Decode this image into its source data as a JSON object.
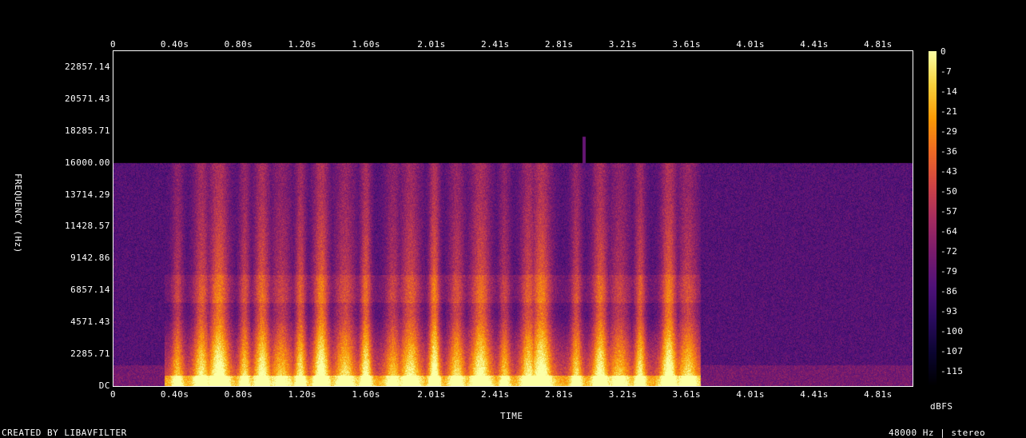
{
  "footer": {
    "left": "CREATED BY LIBAVFILTER",
    "right": "48000 Hz | stereo"
  },
  "colors": {
    "background": "#000000",
    "axis": "#ffffff",
    "colormap": [
      "#000000",
      "#0b0530",
      "#2a0b5e",
      "#51127a",
      "#7a1b6d",
      "#a52c60",
      "#cf4446",
      "#ed6925",
      "#fb9b06",
      "#f7d13d",
      "#fcffa4"
    ]
  },
  "chart_data": {
    "type": "heatmap",
    "title": "",
    "xlabel": "TIME",
    "ylabel": "FREQUENCY (Hz)",
    "x_ticks_top": [
      "0",
      "0.40s",
      "0.80s",
      "1.20s",
      "1.60s",
      "2.01s",
      "2.41s",
      "2.81s",
      "3.21s",
      "3.61s",
      "4.01s",
      "4.41s",
      "4.81s"
    ],
    "x_ticks_bottom": [
      "0",
      "0.40s",
      "0.80s",
      "1.20s",
      "1.60s",
      "2.01s",
      "2.41s",
      "2.81s",
      "3.21s",
      "3.61s",
      "4.01s",
      "4.41s",
      "4.81s"
    ],
    "x_tick_values": [
      0,
      0.4,
      0.8,
      1.2,
      1.6,
      2.01,
      2.41,
      2.81,
      3.21,
      3.61,
      4.01,
      4.41,
      4.81
    ],
    "xlim": [
      0,
      5.01
    ],
    "y_ticks": [
      "22857.14",
      "20571.43",
      "18285.71",
      "16000.00",
      "13714.29",
      "11428.57",
      "9142.86",
      "6857.14",
      "4571.43",
      "2285.71",
      "DC"
    ],
    "y_tick_values": [
      22857.14,
      20571.43,
      18285.71,
      16000.0,
      13714.29,
      11428.57,
      9142.86,
      6857.14,
      4571.43,
      2285.71,
      0
    ],
    "ylim": [
      0,
      24000
    ],
    "colorbar": {
      "label": "dBFS",
      "ticks": [
        "0",
        "-7",
        "-14",
        "-21",
        "-29",
        "-36",
        "-43",
        "-50",
        "-57",
        "-64",
        "-72",
        "-79",
        "-86",
        "-93",
        "-100",
        "-107",
        "-115"
      ],
      "range": [
        -120,
        0
      ]
    },
    "content_cutoff_hz": 16000,
    "speech_end_s": 3.68,
    "grid": false
  }
}
